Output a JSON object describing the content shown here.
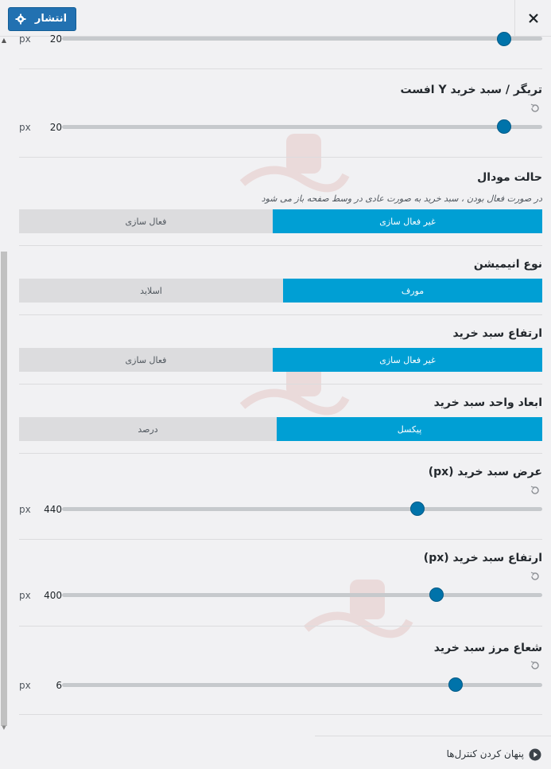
{
  "header": {
    "publish_label": "انتشار"
  },
  "sections": {
    "top_slider": {
      "unit": "px",
      "value": "20",
      "fraction": 0.92
    },
    "trigger_y_offset": {
      "title": "تریگر / سبد خرید Y افست",
      "unit": "px",
      "value": "20",
      "fraction": 0.92
    },
    "modal_mode": {
      "title": "حالت مودال",
      "description": "در صورت فعال بودن ، سبد خرید به صورت عادی در وسط صفحه باز می شود",
      "option_active": "غیر فعال سازی",
      "option_inactive": "فعال سازی"
    },
    "animation_type": {
      "title": "نوع انیمیشن",
      "option_active": "مورف",
      "option_inactive": "اسلاید"
    },
    "cart_height": {
      "title": "ارتفاع سبد خرید",
      "option_active": "غیر فعال سازی",
      "option_inactive": "فعال سازی"
    },
    "cart_unit": {
      "title": "ابعاد واحد سبد خرید",
      "option_active": "پیکسل",
      "option_inactive": "درصد"
    },
    "cart_width_px": {
      "title": "عرض سبد خرید (px)",
      "unit": "px",
      "value": "440",
      "fraction": 0.74
    },
    "cart_height_px": {
      "title": "ارتفاع سبد خرید (px)",
      "unit": "px",
      "value": "400",
      "fraction": 0.78
    },
    "border_radius": {
      "title": "شعاع مرز سبد خرید",
      "unit": "px",
      "value": "6",
      "fraction": 0.82
    }
  },
  "footer": {
    "hide_controls_label": "پنهان کردن کنترل‌ها"
  },
  "colors": {
    "accent": "#009fd4",
    "publish": "#2271b1",
    "knob": "#0073aa"
  },
  "icons": [
    "gear-icon",
    "close-icon",
    "reset-icon",
    "play-icon",
    "scroll-up-icon",
    "scroll-down-icon"
  ]
}
